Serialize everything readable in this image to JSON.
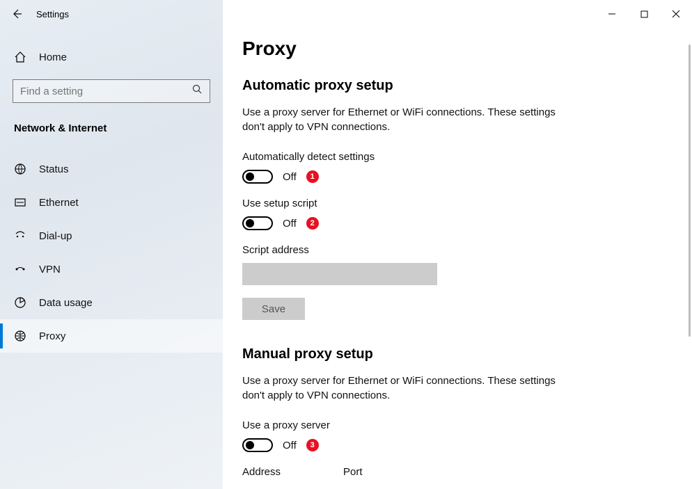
{
  "titlebar": {
    "title": "Settings"
  },
  "sidebar": {
    "home_label": "Home",
    "search_placeholder": "Find a setting",
    "category_label": "Network & Internet",
    "items": [
      {
        "label": "Status"
      },
      {
        "label": "Ethernet"
      },
      {
        "label": "Dial-up"
      },
      {
        "label": "VPN"
      },
      {
        "label": "Data usage"
      },
      {
        "label": "Proxy"
      }
    ]
  },
  "content": {
    "page_title": "Proxy",
    "auto": {
      "heading": "Automatic proxy setup",
      "description": "Use a proxy server for Ethernet or WiFi connections. These settings don't apply to VPN connections.",
      "detect_label": "Automatically detect settings",
      "detect_state": "Off",
      "detect_badge": "1",
      "script_label": "Use setup script",
      "script_state": "Off",
      "script_badge": "2",
      "address_label": "Script address",
      "save_label": "Save"
    },
    "manual": {
      "heading": "Manual proxy setup",
      "description": "Use a proxy server for Ethernet or WiFi connections. These settings don't apply to VPN connections.",
      "use_label": "Use a proxy server",
      "use_state": "Off",
      "use_badge": "3",
      "address_label": "Address",
      "port_label": "Port"
    }
  }
}
